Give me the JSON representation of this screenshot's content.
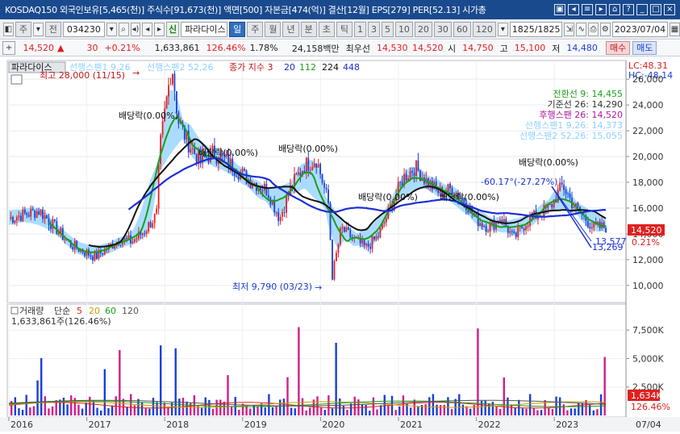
{
  "titlebar": {
    "text": "KOSDAQ150 외국인보유[5,465(천)] 주식수[91,673(천)] 액면[500] 자본금[474(억)] 결산[12월] EPS[279] PER[52.13] 시가총",
    "icons": [
      "save-icon",
      "prev-icon",
      "table-icon",
      "next-icon",
      "home-icon",
      "question-icon",
      "minimize-icon",
      "maximize-icon",
      "close-icon"
    ]
  },
  "toolbar": {
    "market": "주",
    "type": "전",
    "code": "034230",
    "badge": "신",
    "name": "파라다이스",
    "periods": [
      "일",
      "주",
      "월",
      "년",
      "분",
      "초",
      "틱"
    ],
    "active_period": "일",
    "intervals": [
      "1",
      "3",
      "5",
      "10",
      "20",
      "30",
      "60",
      "120"
    ],
    "count": "1825/1825",
    "date": "2023/07/04"
  },
  "pricebar": {
    "price": "14,520",
    "arrow": "▲",
    "change": "30",
    "change_pct": "+0.21%",
    "volume": "1,633,861",
    "volume_pct": "126.46%",
    "turnover": "1.78%",
    "amount": "24,158백만",
    "bid_label": "최우선",
    "bid1": "14,530",
    "bid2": "14,520",
    "open_label": "시",
    "open": "14,750",
    "high_label": "고",
    "high": "15,100",
    "low_label": "저",
    "low": "14,480",
    "buy": "매수",
    "sell": "매도"
  },
  "legend": {
    "stock": "파라다이스",
    "span1": "선행스팬1 9,26",
    "span2": "선행스팬2 52,26",
    "ma_label": "종가 지수 3",
    "ma_values": [
      "20",
      "112",
      "224",
      "448"
    ],
    "right_top": "LC:48.31",
    "right_bot": "HC:-48.14"
  },
  "ichimoku": {
    "conv": "전환선 9: 14,455",
    "base": "기준선 26: 14,290",
    "lag": "후행스팬 26: 14,520",
    "lead1": "선행스팬1 9,26: 14,373",
    "lead2": "선행스팬2 52,26: 15,055"
  },
  "annotations": {
    "high": "최고 28,000 (11/15)",
    "low": "최저 9,790 (03/23)",
    "dividend": "배당락(0.00%)",
    "trend": "-60.17°(-27.27%)",
    "end_pct": "0.21%",
    "end_val1": "13,577",
    "end_val2": "13,269"
  },
  "price_axis": [
    "26,000",
    "24,000",
    "22,000",
    "20,000",
    "18,000",
    "16,000",
    "14,000",
    "12,000",
    "10,000"
  ],
  "price_tag": "14,520",
  "volume": {
    "label": "거래량",
    "ma_label": "단순",
    "ma": [
      "5",
      "20",
      "60",
      "120"
    ],
    "value": "1,633,861주(126.46%)",
    "axis": [
      "7,500K",
      "5,000K",
      "2,500K"
    ],
    "tag": "1,634K",
    "tag_pct": "126.46%"
  },
  "x_axis": [
    "2016",
    "2017",
    "2018",
    "2019",
    "2020",
    "2021",
    "2022",
    "2023"
  ],
  "x_end": "07/04",
  "colors": {
    "up": "#e0201f",
    "down": "#1a3fd6",
    "cloud": "#8fd0ff",
    "conv": "#1a9e1a",
    "base": "#111111",
    "long": "#1b2fd6"
  }
}
